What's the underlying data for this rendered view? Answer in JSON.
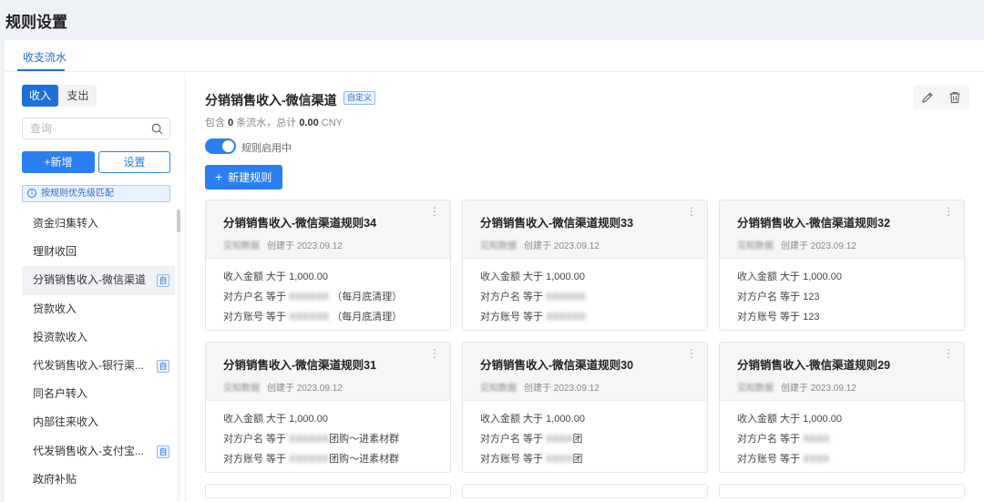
{
  "page": {
    "title": "规则设置"
  },
  "tabs": [
    {
      "label": "收支流水"
    }
  ],
  "sidebar": {
    "segments": {
      "income": "收入",
      "expense": "支出"
    },
    "search_placeholder": "查询",
    "add_label": "+新增",
    "settings_label": "设置",
    "hint": "按规则优先级匹配",
    "hint_icon": "i",
    "items": [
      {
        "label": "资金归集转入",
        "badge": ""
      },
      {
        "label": "理财收回",
        "badge": ""
      },
      {
        "label": "分销销售收入-微信渠道",
        "badge": "自"
      },
      {
        "label": "贷款收入",
        "badge": ""
      },
      {
        "label": "投资款收入",
        "badge": ""
      },
      {
        "label": "代发销售收入-银行渠...",
        "badge": "自"
      },
      {
        "label": "同名户转入",
        "badge": ""
      },
      {
        "label": "内部往来收入",
        "badge": ""
      },
      {
        "label": "代发销售收入-支付宝...",
        "badge": "自"
      },
      {
        "label": "政府补贴",
        "badge": ""
      }
    ]
  },
  "content": {
    "title": "分销销售收入-微信渠道",
    "tag": "自定义",
    "summary_prefix": "包含",
    "summary_count": "0",
    "summary_mid": "条流水，总计",
    "summary_total": "0.00",
    "summary_currency": "CNY",
    "toggle_label": "规则启用中",
    "toggle_on": true,
    "new_rule_label": "新建规则",
    "edit_icon": "pencil-icon",
    "delete_icon": "trash-icon"
  },
  "cards": [
    {
      "title": "分销销售收入-微信渠道规则34",
      "org": "见知数据",
      "created": "创建于 2023.09.12",
      "conds": [
        {
          "label": "收入金额 大于 1,000.00",
          "blur": "",
          "suffix": ""
        },
        {
          "label": "对方户名 等于",
          "blur": "XXXXXX",
          "suffix": "（每月底清理）"
        },
        {
          "label": "对方账号 等于",
          "blur": "XXXXXX",
          "suffix": "（每月底清理）"
        }
      ]
    },
    {
      "title": "分销销售收入-微信渠道规则33",
      "org": "见知数据",
      "created": "创建于 2023.09.12",
      "conds": [
        {
          "label": "收入金额 大于 1,000.00",
          "blur": "",
          "suffix": ""
        },
        {
          "label": "对方户名 等于",
          "blur": "XXXXXX",
          "suffix": ""
        },
        {
          "label": "对方账号 等于",
          "blur": "XXXXXX",
          "suffix": ""
        }
      ]
    },
    {
      "title": "分销销售收入-微信渠道规则32",
      "org": "见知数据",
      "created": "创建于 2023.09.12",
      "conds": [
        {
          "label": "收入金额 大于 1,000.00",
          "blur": "",
          "suffix": ""
        },
        {
          "label": "对方户名 等于 123",
          "blur": "",
          "suffix": ""
        },
        {
          "label": "对方账号 等于 123",
          "blur": "",
          "suffix": ""
        }
      ]
    },
    {
      "title": "分销销售收入-微信渠道规则31",
      "org": "见知数据",
      "created": "创建于 2023.09.12",
      "conds": [
        {
          "label": "收入金额 大于 1,000.00",
          "blur": "",
          "suffix": ""
        },
        {
          "label": "对方户名 等于",
          "blur": "XXXXXX",
          "suffix": "团购～进素材群"
        },
        {
          "label": "对方账号 等于",
          "blur": "XXXXXX",
          "suffix": "团购～进素材群"
        }
      ]
    },
    {
      "title": "分销销售收入-微信渠道规则30",
      "org": "见知数据",
      "created": "创建于 2023.09.12",
      "conds": [
        {
          "label": "收入金额 大于 1,000.00",
          "blur": "",
          "suffix": ""
        },
        {
          "label": "对方户名 等于",
          "blur": "XXXX",
          "suffix": "团"
        },
        {
          "label": "对方账号 等于",
          "blur": "XXXX",
          "suffix": "团"
        }
      ]
    },
    {
      "title": "分销销售收入-微信渠道规则29",
      "org": "见知数据",
      "created": "创建于 2023.09.12",
      "conds": [
        {
          "label": "收入金额 大于 1,000.00",
          "blur": "",
          "suffix": ""
        },
        {
          "label": "对方户名 等于",
          "blur": "XXXX",
          "suffix": ""
        },
        {
          "label": "对方账号 等于",
          "blur": "XXXX",
          "suffix": ""
        }
      ]
    }
  ]
}
